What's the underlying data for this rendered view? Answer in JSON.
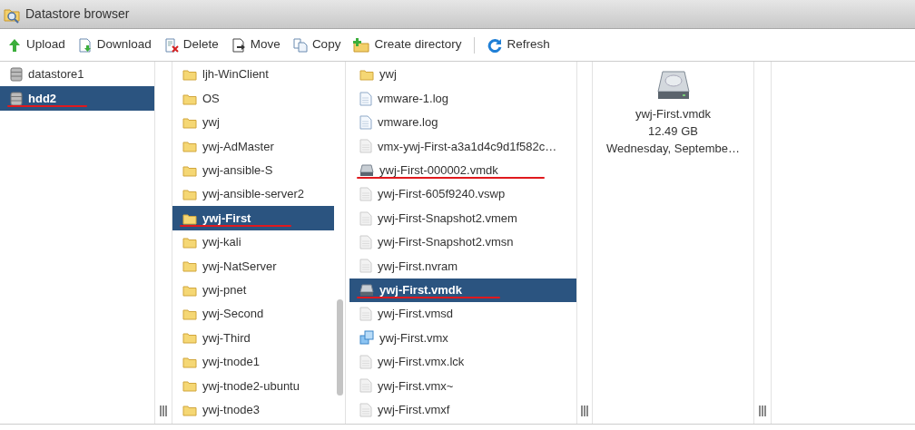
{
  "window": {
    "title": "Datastore browser"
  },
  "toolbar": [
    {
      "label": "Upload",
      "kind": "upload"
    },
    {
      "label": "Download",
      "kind": "download"
    },
    {
      "label": "Delete",
      "kind": "delete"
    },
    {
      "label": "Move",
      "kind": "move"
    },
    {
      "label": "Copy",
      "kind": "copy"
    },
    {
      "label": "Create directory",
      "kind": "mkdir"
    },
    {
      "label": "Refresh",
      "kind": "refresh",
      "separator_before": true
    }
  ],
  "datastores": [
    {
      "name": "datastore1",
      "kind": "datastore",
      "selected": false,
      "underlined": false
    },
    {
      "name": "hdd2",
      "kind": "datastore",
      "selected": true,
      "underlined": true
    }
  ],
  "folders": [
    {
      "name": "ljh-WinClient",
      "kind": "folder",
      "selected": false,
      "underlined": false
    },
    {
      "name": "OS",
      "kind": "folder",
      "selected": false,
      "underlined": false
    },
    {
      "name": "ywj",
      "kind": "folder",
      "selected": false,
      "underlined": false
    },
    {
      "name": "ywj-AdMaster",
      "kind": "folder",
      "selected": false,
      "underlined": false
    },
    {
      "name": "ywj-ansible-S",
      "kind": "folder",
      "selected": false,
      "underlined": false
    },
    {
      "name": "ywj-ansible-server2",
      "kind": "folder",
      "selected": false,
      "underlined": false
    },
    {
      "name": "ywj-First",
      "kind": "folder",
      "selected": true,
      "underlined": true
    },
    {
      "name": "ywj-kali",
      "kind": "folder",
      "selected": false,
      "underlined": false
    },
    {
      "name": "ywj-NatServer",
      "kind": "folder",
      "selected": false,
      "underlined": false
    },
    {
      "name": "ywj-pnet",
      "kind": "folder",
      "selected": false,
      "underlined": false
    },
    {
      "name": "ywj-Second",
      "kind": "folder",
      "selected": false,
      "underlined": false
    },
    {
      "name": "ywj-Third",
      "kind": "folder",
      "selected": false,
      "underlined": false
    },
    {
      "name": "ywj-tnode1",
      "kind": "folder",
      "selected": false,
      "underlined": false
    },
    {
      "name": "ywj-tnode2-ubuntu",
      "kind": "folder",
      "selected": false,
      "underlined": false
    },
    {
      "name": "ywj-tnode3",
      "kind": "folder",
      "selected": false,
      "underlined": false
    }
  ],
  "files": [
    {
      "name": "ywj",
      "kind": "folder",
      "selected": false,
      "underlined": false
    },
    {
      "name": "vmware-1.log",
      "kind": "log",
      "selected": false,
      "underlined": false
    },
    {
      "name": "vmware.log",
      "kind": "log",
      "selected": false,
      "underlined": false
    },
    {
      "name": "vmx-ywj-First-a3a1d4c9d1f582c…",
      "kind": "file",
      "selected": false,
      "underlined": false
    },
    {
      "name": "ywj-First-000002.vmdk",
      "kind": "disk",
      "selected": false,
      "underlined": true
    },
    {
      "name": "ywj-First-605f9240.vswp",
      "kind": "file",
      "selected": false,
      "underlined": false
    },
    {
      "name": "ywj-First-Snapshot2.vmem",
      "kind": "file",
      "selected": false,
      "underlined": false
    },
    {
      "name": "ywj-First-Snapshot2.vmsn",
      "kind": "file",
      "selected": false,
      "underlined": false
    },
    {
      "name": "ywj-First.nvram",
      "kind": "file",
      "selected": false,
      "underlined": false
    },
    {
      "name": "ywj-First.vmdk",
      "kind": "disk",
      "selected": true,
      "underlined": true
    },
    {
      "name": "ywj-First.vmsd",
      "kind": "file",
      "selected": false,
      "underlined": false
    },
    {
      "name": "ywj-First.vmx",
      "kind": "vmx",
      "selected": false,
      "underlined": false
    },
    {
      "name": "ywj-First.vmx.lck",
      "kind": "file",
      "selected": false,
      "underlined": false
    },
    {
      "name": "ywj-First.vmx~",
      "kind": "file",
      "selected": false,
      "underlined": false
    },
    {
      "name": "ywj-First.vmxf",
      "kind": "file",
      "selected": false,
      "underlined": false
    }
  ],
  "details": {
    "name": "ywj-First.vmdk",
    "size": "12.49 GB",
    "modified": "Wednesday, Septembe…"
  }
}
